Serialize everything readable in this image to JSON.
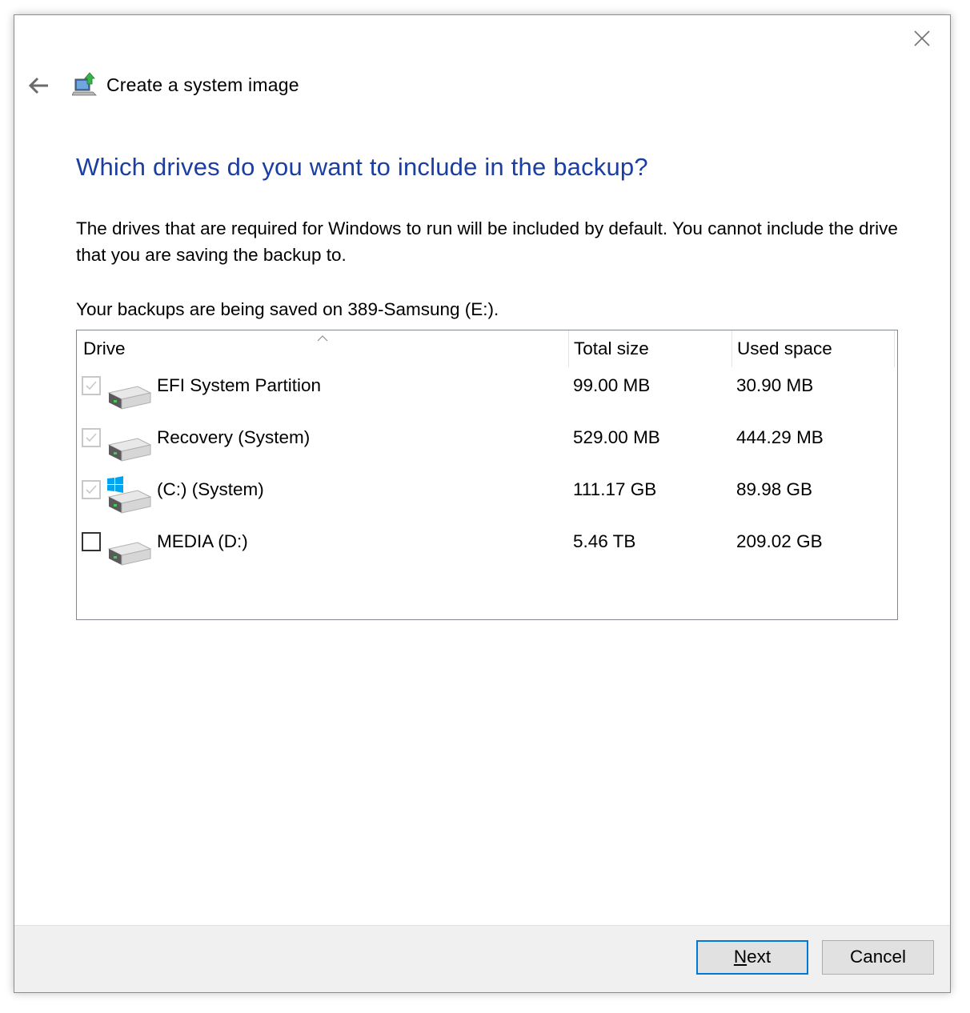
{
  "window": {
    "title": "Create a system image"
  },
  "main": {
    "heading": "Which drives do you want to include in the backup?",
    "description": "The drives that are required for Windows to run will be included by default. You cannot include the drive that you are saving the backup to.",
    "saved_on": "Your backups are being saved on 389-Samsung (E:)."
  },
  "table": {
    "columns": {
      "drive": "Drive",
      "total_size": "Total size",
      "used_space": "Used space"
    },
    "rows": [
      {
        "name": "EFI System Partition",
        "total": "99.00 MB",
        "used": "30.90 MB",
        "checked": true,
        "enabled": false,
        "icon": "drive-icon"
      },
      {
        "name": "Recovery (System)",
        "total": "529.00 MB",
        "used": "444.29 MB",
        "checked": true,
        "enabled": false,
        "icon": "drive-icon"
      },
      {
        "name": "(C:) (System)",
        "total": "111.17 GB",
        "used": "89.98 GB",
        "checked": true,
        "enabled": false,
        "icon": "windows-drive-icon"
      },
      {
        "name": "MEDIA (D:)",
        "total": "5.46 TB",
        "used": "209.02 GB",
        "checked": false,
        "enabled": true,
        "icon": "drive-icon"
      }
    ]
  },
  "footer": {
    "next_mnemonic": "N",
    "next_rest": "ext",
    "cancel_label": "Cancel"
  },
  "colors": {
    "heading": "#1a3ea2",
    "focus_border": "#0078d7",
    "footer_bg": "#f0f0f0"
  }
}
